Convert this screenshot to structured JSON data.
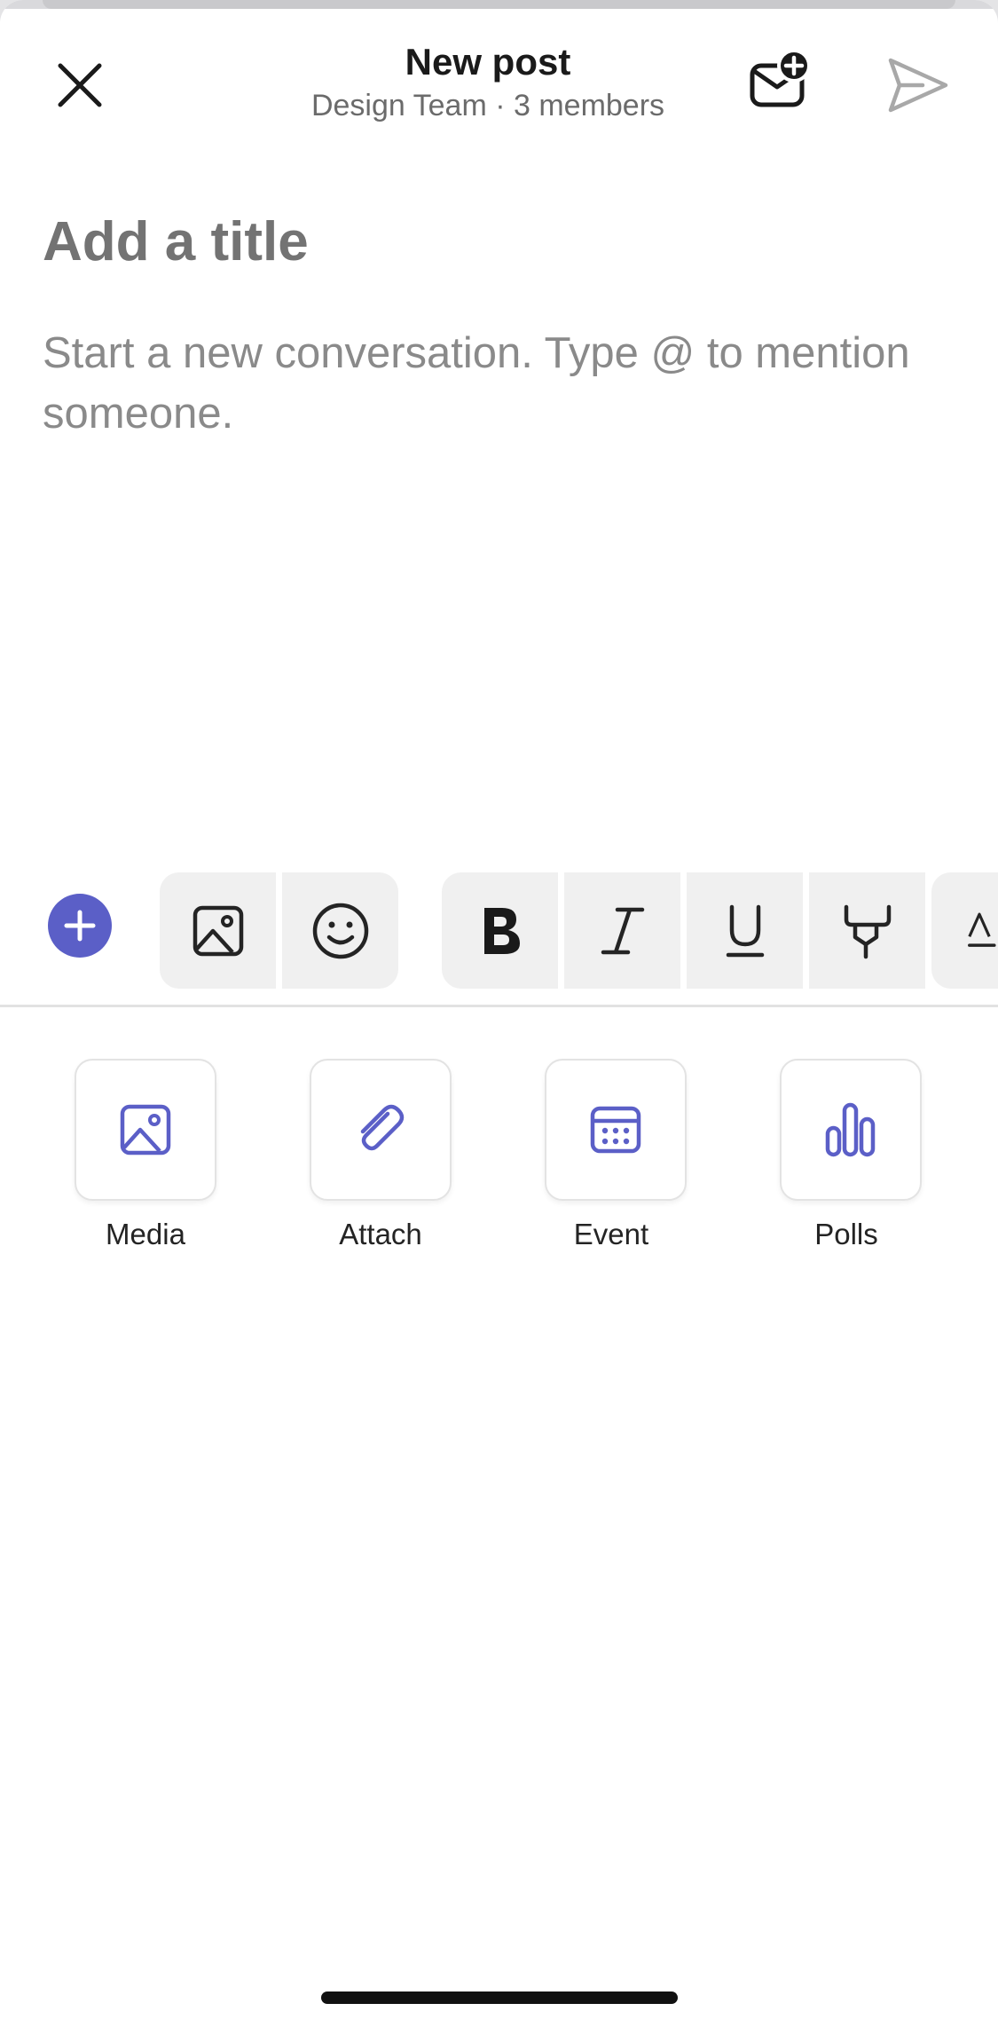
{
  "header": {
    "title": "New post",
    "subtitle": "Design Team · 3 members",
    "close_icon": "close-icon",
    "mail_icon": "new-mail-icon",
    "send_icon": "send-icon"
  },
  "compose": {
    "title_placeholder": "Add a title",
    "body_placeholder": "Start a new conversation. Type @ to mention someone."
  },
  "toolbar": {
    "icons": [
      "add-icon",
      "image-icon",
      "emoji-icon",
      "bold-icon",
      "italic-icon",
      "underline-icon",
      "highlight-icon",
      "font-color-icon"
    ]
  },
  "actions": [
    {
      "label": "Media",
      "icon": "image-icon"
    },
    {
      "label": "Attach",
      "icon": "paperclip-icon"
    },
    {
      "label": "Event",
      "icon": "calendar-icon"
    },
    {
      "label": "Polls",
      "icon": "poll-icon"
    }
  ],
  "colors": {
    "accent": "#5b5fc7",
    "toolbar_bg": "#f0f0f0",
    "placeholder": "#8a8a8a"
  }
}
